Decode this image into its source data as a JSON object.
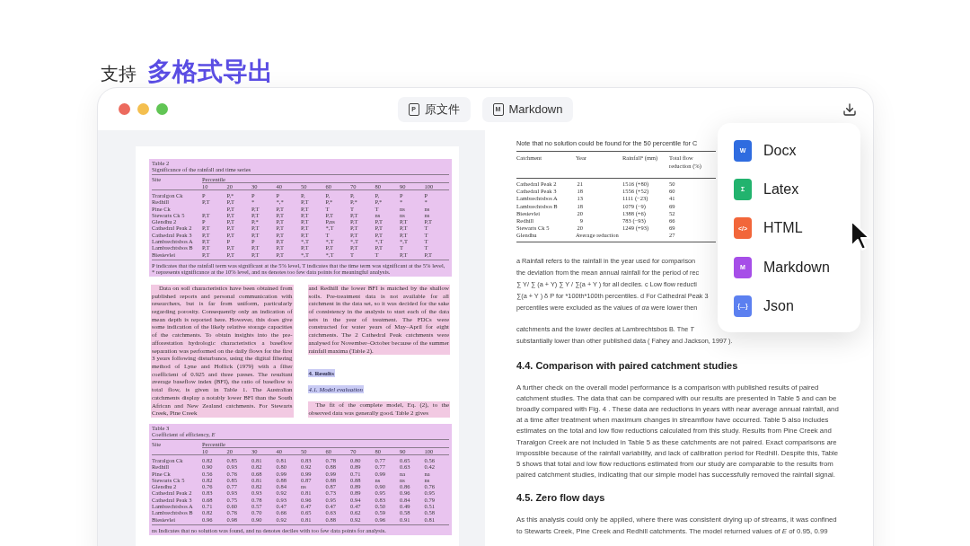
{
  "heading": {
    "lead": "支持",
    "highlight": "多格式导出"
  },
  "window": {
    "tabs": [
      {
        "label": "原文件",
        "glyph": "P"
      },
      {
        "label": "Markdown",
        "glyph": "M"
      }
    ]
  },
  "source_page": {
    "blocks": [
      {
        "kind": "table",
        "caption": "Table 2",
        "title": "Significance of the rainfall and time series",
        "site_header": "Site",
        "group_header": "Percentile",
        "columns": [
          "10",
          "20",
          "30",
          "40",
          "50",
          "60",
          "70",
          "80",
          "90",
          "100"
        ],
        "rows": [
          {
            "site": "Traralgon Ck",
            "values": [
              "P",
              "P,*",
              "P",
              "P",
              "P,",
              "P,",
              "P,",
              "P,",
              "P",
              "P"
            ]
          },
          {
            "site": "Redhill",
            "values": [
              "P,T",
              "P,T",
              "*",
              "*,*",
              "P,T",
              "P,*",
              "P,*",
              "P,*",
              "*",
              "*"
            ]
          },
          {
            "site": "Pine Ck",
            "values": [
              "P,T",
              "P,T",
              "P,T",
              "P,T",
              "T",
              "T",
              "T",
              "ns",
              "ns"
            ]
          },
          {
            "site": "Stewarts Ck 5",
            "values": [
              "P,T",
              "P,T",
              "P,T",
              "P,T",
              "P,T",
              "P,T",
              "P,T",
              "ns",
              "ns",
              "ns"
            ]
          },
          {
            "site": "Glendhu 2",
            "values": [
              "P",
              "P,T",
              "P,*",
              "P,T",
              "P,T",
              "P,ns",
              "P,T",
              "P,T",
              "P,T",
              "P,T"
            ]
          },
          {
            "site": "Cathedral Peak 2",
            "values": [
              "P,T",
              "P,T",
              "P,T",
              "P,T",
              "P,T",
              "*,T",
              "P,T",
              "P,T",
              "P,T",
              "T"
            ]
          },
          {
            "site": "Cathedral Peak 3",
            "values": [
              "P,T",
              "P,T",
              "P,T",
              "P,T",
              "P,T",
              "T",
              "P,T",
              "P,T",
              "P,T",
              "T"
            ]
          },
          {
            "site": "Lambrechtsbos A",
            "values": [
              "P,T",
              "P",
              "P",
              "P,T",
              "*,T",
              "*,T",
              "*,T",
              "*,T",
              "*,T",
              "T"
            ]
          },
          {
            "site": "Lambrechtsbos B",
            "values": [
              "P,T",
              "P,T",
              "P,T",
              "P,T",
              "P,T",
              "P,T",
              "P,T",
              "P,T",
              "T",
              "T"
            ]
          },
          {
            "site": "Biesievlei",
            "values": [
              "P,T",
              "P,T",
              "P,T",
              "P,T",
              "*,T",
              "*,T",
              "T",
              "T",
              "P,T",
              "P,T"
            ]
          }
        ],
        "footnote": "P indicates that the rainfall term was significant at the 5% level, T indicates that the time term was significant at the 5% level, * represents significance at the 10% level, and ns denotes too few data points for meaningful analysis."
      },
      {
        "kind": "columns",
        "left": [
          {
            "kind": "paragraph",
            "text": "Data on soil characteristics have been obtained from published reports and personal communication with researchers, but is far from uniform, particularly regarding porosity. Consequently only an indication of mean depth is reported here. However, this does give some indication of the likely relative storage capacities of the catchments. To obtain insights into the pre-afforestation hydrologic characteristics a baseflow separation was performed on the daily flows for the first 3 years following disturbance, using the digital filtering method of Lyne and Hollick (1979) with a filter coefficient of 0.925 and three passes. The resultant average baseflow index (BFI), the ratio of baseflow to total flow, is given in Table 1. The Australian catchments display a notably lower BFI than the South African and New Zealand catchments. For Stewarts Creek, Pine Creek"
          }
        ],
        "right": [
          {
            "kind": "paragraph_continued",
            "text": "and Redhill the lower BFI is matched by the shallow soils. Pre-treatment data is not available for all catchment in the data set, so it was decided for the sake of consistency in the analysis to start each of the data sets in the year of treatment. The FDCs were constructed for water years of May–April for eight catchments. The 2 Cathedral Peak catchments were analysed for November–October because of the summer rainfall maxima (Table 2)."
          },
          {
            "kind": "heading",
            "text": "4. Results"
          },
          {
            "kind": "subheading",
            "text": "4.1. Model evaluation"
          },
          {
            "kind": "paragraph",
            "text": "The fit of the complete model, Eq. (2), to the observed data was generally good. Table 2 gives"
          }
        ]
      },
      {
        "kind": "table",
        "caption": "Table 3",
        "title": "Coefficient of efficiency, *E*",
        "site_header": "Site",
        "group_header": "Percentile",
        "columns": [
          "10",
          "20",
          "30",
          "40",
          "50",
          "60",
          "70",
          "80",
          "90",
          "100"
        ],
        "rows": [
          {
            "site": "Traralgon Ck",
            "values": [
              "0.82",
              "0.85",
              "0.81",
              "0.81",
              "0.83",
              "0.78",
              "0.80",
              "0.77",
              "0.65",
              "0.56"
            ]
          },
          {
            "site": "Redhill",
            "values": [
              "0.90",
              "0.93",
              "0.82",
              "0.80",
              "0.92",
              "0.88",
              "0.89",
              "0.77",
              "0.63",
              "0.42"
            ]
          },
          {
            "site": "Pine Ck",
            "values": [
              "0.56",
              "0.76",
              "0.68",
              "0.99",
              "0.99",
              "0.99",
              "0.71",
              "0.99",
              "na",
              "na"
            ]
          },
          {
            "site": "Stewarts Ck 5",
            "values": [
              "0.82",
              "0.85",
              "0.81",
              "0.88",
              "0.87",
              "0.88",
              "0.88",
              "ns",
              "ns",
              "ns"
            ]
          },
          {
            "site": "Glendhu 2",
            "values": [
              "0.76",
              "0.77",
              "0.82",
              "0.84",
              "ns",
              "0.87",
              "0.89",
              "0.90",
              "0.86",
              "0.76"
            ]
          },
          {
            "site": "Cathedral Peak 2",
            "values": [
              "0.83",
              "0.93",
              "0.93",
              "0.92",
              "0.81",
              "0.73",
              "0.89",
              "0.95",
              "0.96",
              "0.95"
            ]
          },
          {
            "site": "Cathedral Peak 3",
            "values": [
              "0.68",
              "0.75",
              "0.78",
              "0.93",
              "0.96",
              "0.95",
              "0.94",
              "0.83",
              "0.84",
              "0.79"
            ]
          },
          {
            "site": "Lambrechtsbos A",
            "values": [
              "0.71",
              "0.60",
              "0.57",
              "0.47",
              "0.47",
              "0.47",
              "0.47",
              "0.50",
              "0.49",
              "0.51"
            ]
          },
          {
            "site": "Lambrechtsbos B",
            "values": [
              "0.82",
              "0.76",
              "0.70",
              "0.66",
              "0.65",
              "0.63",
              "0.62",
              "0.59",
              "0.58",
              "0.58"
            ]
          },
          {
            "site": "Biesievlei",
            "values": [
              "0.96",
              "0.98",
              "0.90",
              "0.92",
              "0.81",
              "0.88",
              "0.92",
              "0.96",
              "0.91",
              "0.81"
            ]
          }
        ],
        "footnote": "ns Indicates that no solution was found, and na denotes deciles with too few data points for analysis."
      }
    ]
  },
  "markdown_view": {
    "blocks": [
      {
        "kind": "note",
        "text": "Note that no solution could be found for the 50 percentile for C"
      },
      {
        "kind": "table",
        "columns": [
          "Catchment",
          "Year",
          "Rainfall$^{a}$ (mm)",
          "Total flow reduction (%)"
        ],
        "rows": [
          [
            "Cathedral Peak 2",
            "21",
            "1516 (+80)",
            "50"
          ],
          [
            "Cathedral Peak 3",
            "18",
            "1556 (+52)",
            "60"
          ],
          [
            "Lambrechtsbos A",
            "13",
            "1111 (−23)",
            "41"
          ],
          [
            "Lambrechtsbos B",
            "18",
            "1079 (−9)",
            "69"
          ],
          [
            "Biesievlei",
            "20",
            "1388 (+6)",
            "52"
          ],
          [
            "Redhill",
            "9",
            "783 (−93)",
            "66"
          ],
          [
            "Stewarts Ck 5",
            "20",
            "1249 (+93)",
            "69"
          ],
          [
            "Glendhu",
            "Average reduction",
            "",
            "27"
          ]
        ]
      },
      {
        "kind": "lines",
        "lines": [
          "a Rainfall refers to the rainfall in the year used for comparison",
          "the deviation from the mean annual rainfall for the period of rec",
          "∑ Y/ ∑ (a + Y) ∑ Y / ∑(a + Y ) for all deciles. c Low flow reducti",
          "∑(a + Y ) δ P for *100th*100th percentiles. d For Cathedral Peak 3",
          "percentiles were excluded as the values of *αa* were lower then"
        ]
      },
      {
        "kind": "lines",
        "lines": [
          "catchments and the lower deciles at Lambrechtsbos B. The *T*",
          "substantially lower than other published data ( Fahey and Jackson, 1997 )."
        ]
      },
      {
        "kind": "heading",
        "text": "4.4. Comparison with paired catchment studies"
      },
      {
        "kind": "paragraph",
        "text": "A further check on the overall model performance is a comparison with published results of paired catchment studies. The data that can be compared with our results are presented in Table 5 and can be broadly compared with Fig. 4 . These data are reductions in years with near average annual rainfall, and at a time after treatment when maximum changes in streamflow have occurred. Table 5 also includes estimates on the total and low flow reductions calculated from this study. Results from Pine Creek and Traralgon Creek are not included in Table 5 as these catchments are not paired. Exact comparisons are impossible because of the rainfall variability, and lack of calibration period for Redhill. Despite this, Table 5 shows that total and low flow reductions estimated from our study are comparable to the results from paired catchment studies, indicating that our simple model has successfully removed the rainfall signal."
      },
      {
        "kind": "heading",
        "text": "4.5. Zero flow days"
      },
      {
        "kind": "paragraph",
        "text": "As this analysis could only be applied, where there was consistent drying up of streams, it was confined to Stewarts Creek, Pine Creek and Redhill catchments. The model returned values of *E* of 0.95, 0.99"
      }
    ]
  },
  "export_menu": {
    "items": [
      {
        "label": "Docx",
        "glyph": "W",
        "color": "#2f6ce0"
      },
      {
        "label": "Latex",
        "glyph": "Σ",
        "color": "#22b36e"
      },
      {
        "label": "HTML",
        "glyph": "</>",
        "color": "#f2663a"
      },
      {
        "label": "Markdown",
        "glyph": "M",
        "color": "#a64ee8"
      },
      {
        "label": "Json",
        "glyph": "{...}",
        "color": "#5c80f0"
      }
    ]
  }
}
